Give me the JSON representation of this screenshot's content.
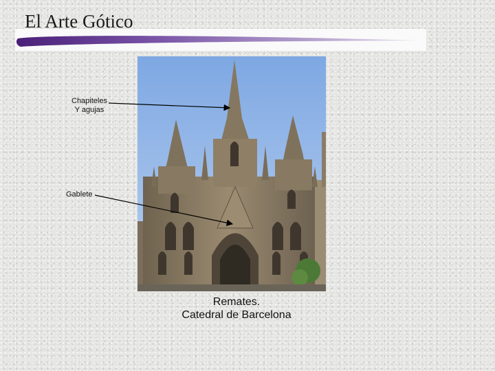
{
  "slide": {
    "title": "El Arte Gótico",
    "labels": {
      "spires_line1": "Chapiteles",
      "spires_line2": "Y agujas",
      "gable": "Gablete"
    },
    "caption": {
      "line1": "Remates.",
      "line2": "Catedral de Barcelona"
    }
  },
  "colors": {
    "title_swoosh": "#5b2a8a",
    "sky": "#8fb4e6",
    "stone": "#8a7a62"
  }
}
